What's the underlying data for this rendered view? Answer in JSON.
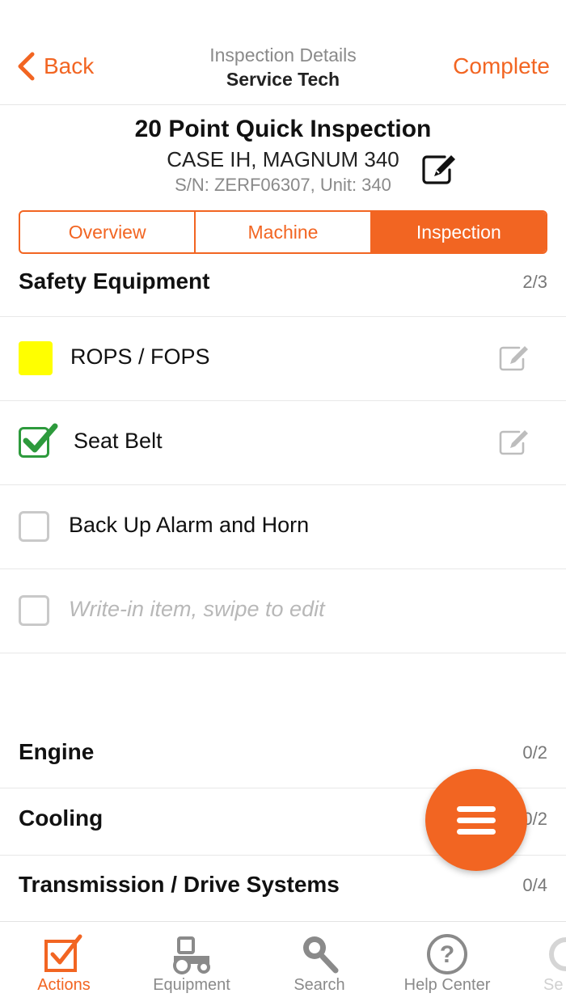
{
  "nav": {
    "back_label": "Back",
    "title_line1": "Inspection Details",
    "title_line2": "Service Tech",
    "complete_label": "Complete"
  },
  "header": {
    "title": "20 Point Quick Inspection",
    "model": "CASE IH, MAGNUM 340",
    "serial": "S/N: ZERF06307, Unit: 340"
  },
  "tabs": [
    {
      "label": "Overview",
      "active": false
    },
    {
      "label": "Machine",
      "active": false
    },
    {
      "label": "Inspection",
      "active": true
    }
  ],
  "sections": [
    {
      "name": "Safety Equipment",
      "count": "2/3",
      "items": [
        {
          "label": "ROPS / FOPS",
          "state": "yellow",
          "editable": true
        },
        {
          "label": "Seat Belt",
          "state": "checked",
          "editable": true
        },
        {
          "label": "Back Up Alarm and Horn",
          "state": "unchecked",
          "editable": false
        },
        {
          "label": "Write-in item, swipe to edit",
          "state": "placeholder",
          "editable": false
        }
      ]
    },
    {
      "name": "Engine",
      "count": "0/2"
    },
    {
      "name": "Cooling",
      "count": "0/2"
    },
    {
      "name": "Transmission / Drive Systems",
      "count": "0/4"
    }
  ],
  "tabbar": [
    {
      "label": "Actions",
      "icon": "checkbox-icon",
      "active": true
    },
    {
      "label": "Equipment",
      "icon": "tractor-icon",
      "active": false
    },
    {
      "label": "Search",
      "icon": "search-icon",
      "active": false
    },
    {
      "label": "Help Center",
      "icon": "help-icon",
      "active": false
    },
    {
      "label": "Se",
      "icon": "settings-icon",
      "active": false
    }
  ],
  "colors": {
    "accent": "#f26522",
    "check_green": "#2d9a3c",
    "flag_yellow": "#ffff00",
    "muted_text": "#8a8a8a"
  }
}
